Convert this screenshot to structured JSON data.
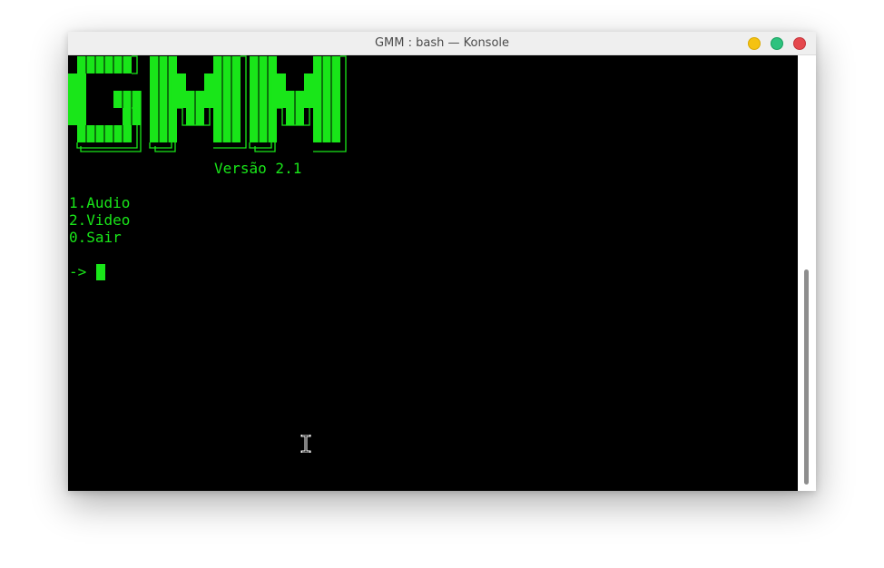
{
  "window": {
    "title": "GMM : bash — Konsole"
  },
  "terminal": {
    "banner_text": "GMM",
    "version": "Versão 2.1",
    "menu": [
      "1.Audio",
      "2.Video",
      "0.Sair"
    ],
    "prompt": "->"
  },
  "colors": {
    "terminal_background": "#000000",
    "terminal_text": "#19e619",
    "titlebar": "#efefef",
    "minimize": "#f5c211",
    "maximize": "#2ec27e",
    "close": "#e5484d"
  },
  "icons": {
    "minimize": "minimize-icon",
    "maximize": "maximize-icon",
    "close": "close-icon",
    "text_cursor": "i-beam-cursor-icon"
  }
}
